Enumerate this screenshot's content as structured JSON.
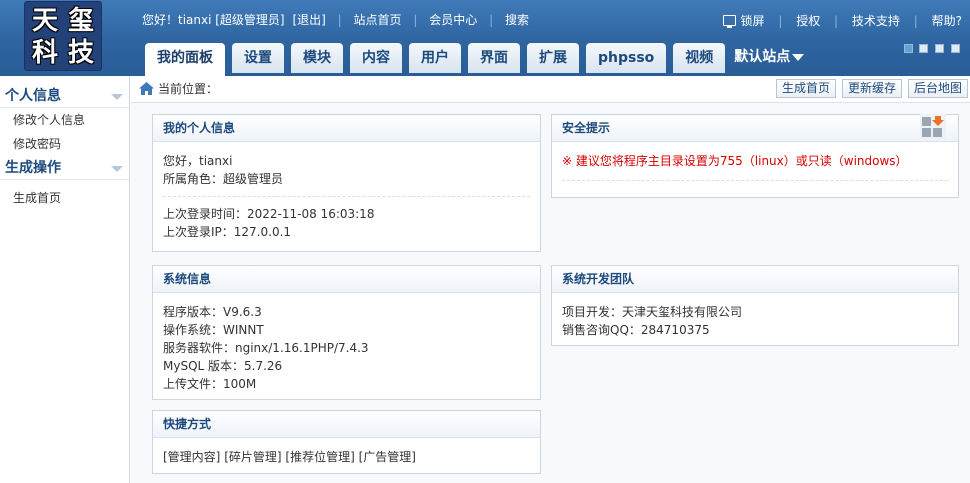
{
  "logo": {
    "chars": [
      "天",
      "玺",
      "科",
      "技"
    ]
  },
  "topbar": {
    "greeting": "您好！tianxi [超级管理员]",
    "logout": "[退出]",
    "site_home": "站点首页",
    "member_center": "会员中心",
    "search": "搜索"
  },
  "topright": {
    "lock_screen": "锁屏",
    "authorize": "授权",
    "tech_support": "技术支持",
    "help": "帮助?"
  },
  "tabs": [
    {
      "label": "我的面板",
      "active": true
    },
    {
      "label": "设置"
    },
    {
      "label": "模块"
    },
    {
      "label": "内容"
    },
    {
      "label": "用户"
    },
    {
      "label": "界面"
    },
    {
      "label": "扩展"
    },
    {
      "label": "phpsso"
    },
    {
      "label": "视频"
    }
  ],
  "site_select": {
    "label": "默认站点"
  },
  "sidebar": {
    "groups": [
      {
        "title": "个人信息",
        "items": [
          "修改个人信息",
          "修改密码"
        ]
      },
      {
        "title": "生成操作",
        "items": [
          "生成首页"
        ]
      }
    ]
  },
  "crumb": {
    "label": "当前位置：",
    "buttons": [
      "生成首页",
      "更新缓存",
      "后台地图"
    ]
  },
  "panels": {
    "profile": {
      "title": "我的个人信息",
      "hello": "您好，tianxi",
      "role": "所属角色：超级管理员",
      "last_login_time": "上次登录时间：2022-11-08 16:03:18",
      "last_login_ip": "上次登录IP：127.0.0.1"
    },
    "security": {
      "title": "安全提示",
      "tip": "※ 建议您将程序主目录设置为755（linux）或只读（windows）"
    },
    "sysinfo": {
      "title": "系统信息",
      "lines": [
        "程序版本：V9.6.3",
        "操作系统：WINNT",
        "服务器软件：nginx/1.16.1PHP/7.4.3",
        "MySQL 版本：5.7.26",
        "上传文件：100M"
      ]
    },
    "team": {
      "title": "系统开发团队",
      "dev": "项目开发：天津天玺科技有限公司",
      "sales": "销售咨询QQ：284710375"
    },
    "shortcuts": {
      "title": "快捷方式",
      "links": [
        "[管理内容]",
        "[碎片管理]",
        "[推荐位管理]",
        "[广告管理]"
      ]
    }
  },
  "colors": {
    "header": "#2d639f",
    "tab_text": "#1d4a7e",
    "warning": "#d60000"
  }
}
